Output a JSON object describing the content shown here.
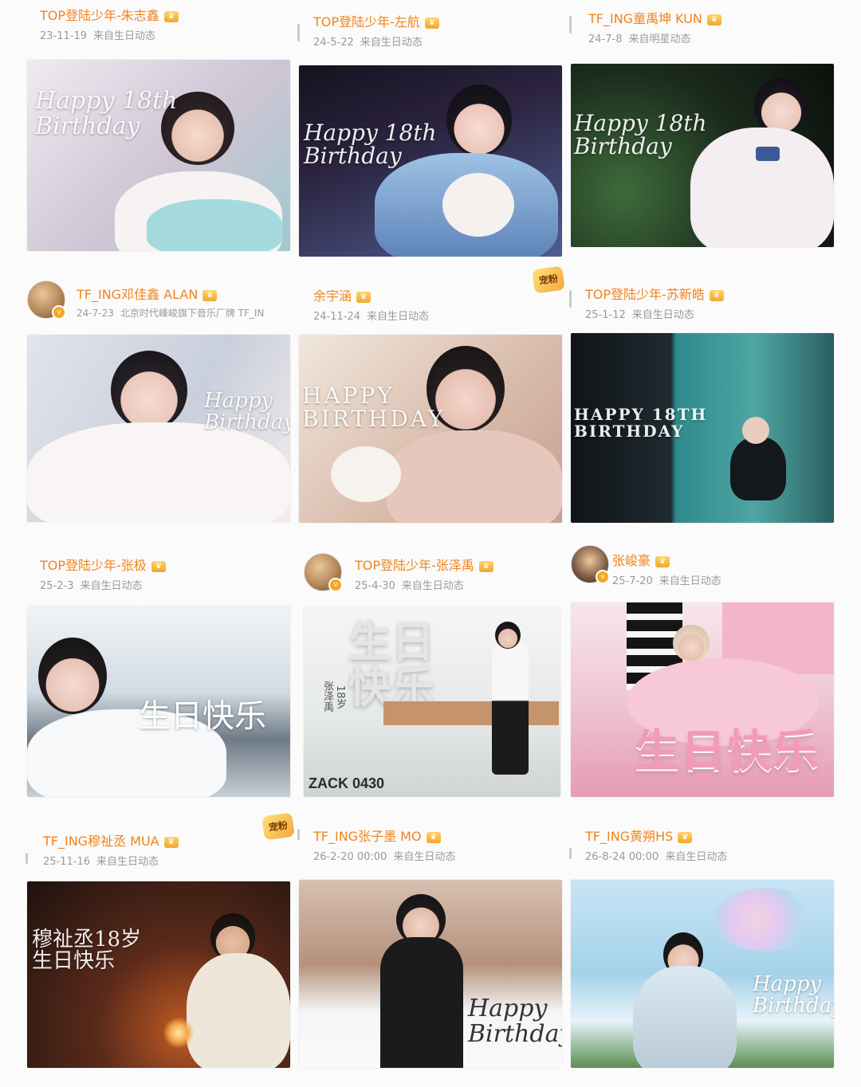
{
  "posts": [
    {
      "user": "TOP登陆少年-朱志鑫",
      "date": "23-11-19",
      "source": "来自生日动态",
      "photo_text": "Happy 18th\nBirthday",
      "colors": [
        "#e9e3ea",
        "#b9aebf",
        "#7fb7c4"
      ]
    },
    {
      "user": "TOP登陆少年-左航",
      "date": "24-5-22",
      "source": "来自生日动态",
      "photo_text": "Happy 18th\nBirthday",
      "colors": [
        "#2a2238",
        "#5e6fa8",
        "#e8c3d7"
      ]
    },
    {
      "user": "TF_ING童禹坤 KUN",
      "date": "24-7-8",
      "source": "来自明星动态",
      "photo_text": "Happy 18th\nBirthday",
      "colors": [
        "#101812",
        "#3a5b3a",
        "#f2eef3"
      ]
    },
    {
      "user": "TF_ING邓佳鑫 ALAN",
      "date": "24-7-23",
      "source": "北京时代峰峻旗下音乐厂牌 TF_IN",
      "photo_text": "Happy\nBirthday",
      "colors": [
        "#d9dbe5",
        "#a9b4c8",
        "#f7f2f2"
      ]
    },
    {
      "user": "余宇涵",
      "date": "24-11-24",
      "source": "来自生日动态",
      "photo_text": "HAPPY\nBIRTHDAY",
      "colors": [
        "#efe2d6",
        "#b99282",
        "#e9cfc4"
      ]
    },
    {
      "user": "TOP登陆少年-苏新皓",
      "date": "25-1-12",
      "source": "来自生日动态",
      "photo_text": "HAPPY 18TH\nBIRTHDAY",
      "colors": [
        "#121c22",
        "#2c7b7e",
        "#75a9a5"
      ]
    },
    {
      "user": "TOP登陆少年-张极",
      "date": "25-2-3",
      "source": "来自生日动态",
      "photo_text": "生日快乐",
      "colors": [
        "#eef2f4",
        "#b7c3cc",
        "#6f7a86"
      ]
    },
    {
      "user": "TOP登陆少年-张泽禹",
      "date": "25-4-30",
      "source": "来自生日动态",
      "photo_text": "生日\n快乐",
      "colors": [
        "#eef0f0",
        "#cfd3d4",
        "#8d6a4e"
      ]
    },
    {
      "user": "张峻豪",
      "date": "25-7-20",
      "source": "来自生日动态",
      "photo_text": "生日快乐",
      "colors": [
        "#f0c9d6",
        "#e89ab5",
        "#d46c93"
      ]
    },
    {
      "user": "TF_ING穆祉丞 MUA",
      "date": "25-11-16",
      "source": "来自生日动态",
      "photo_text": "穆祉丞18岁\n生日快乐",
      "colors": [
        "#2a1610",
        "#6b3322",
        "#f4a64a"
      ]
    },
    {
      "user": "TF_ING张子墨 MO",
      "date": "26-2-20 00:00",
      "source": "来自生日动态",
      "photo_text": "Happy\nBirthday",
      "colors": [
        "#e7d9d0",
        "#a27f6a",
        "#fafafa"
      ]
    },
    {
      "user": "TF_ING黄朔HS",
      "date": "26-8-24 00:00",
      "source": "来自生日动态",
      "photo_text": "Happy\nBirthday",
      "colors": [
        "#bfe0f2",
        "#8fc3de",
        "#e7f3fa"
      ]
    }
  ],
  "extra": {
    "zack_label": "ZACK 0430",
    "zy_name": "张泽禹",
    "zy_age": "18岁",
    "badge_text": "宠粉"
  }
}
